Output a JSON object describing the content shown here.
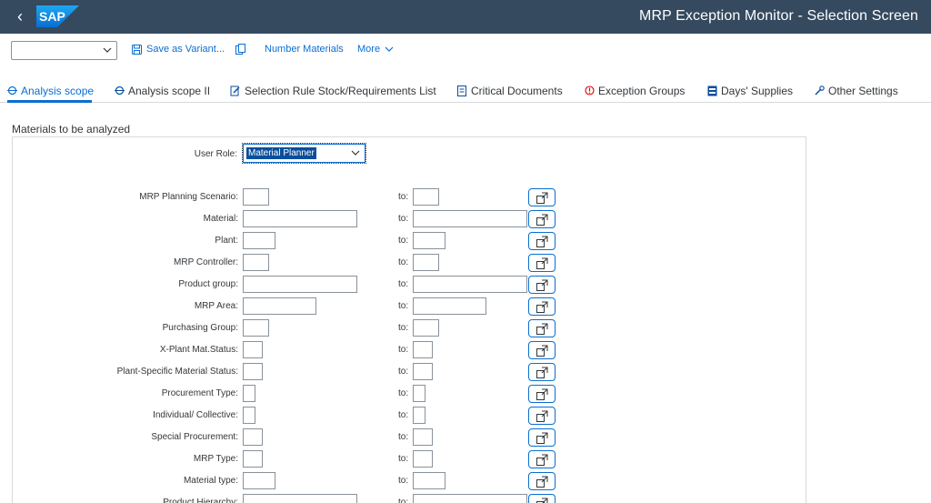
{
  "shell": {
    "back_icon": "back-arrow-icon",
    "logo_text": "SAP",
    "title": "MRP Exception Monitor - Selection Screen"
  },
  "toolbar": {
    "variant_value": "",
    "save_variant_label": "Save as Variant...",
    "number_materials_label": "Number Materials",
    "more_label": "More"
  },
  "tabs": [
    {
      "label": "Analysis scope",
      "icon": "scope-icon",
      "active": true
    },
    {
      "label": "Analysis scope II",
      "icon": "scope-icon",
      "active": false
    },
    {
      "label": "Selection Rule Stock/Requirements List",
      "icon": "selection-rule-icon",
      "active": false
    },
    {
      "label": "Critical Documents",
      "icon": "document-icon",
      "active": false
    },
    {
      "label": "Exception Groups",
      "icon": "exception-icon",
      "active": false
    },
    {
      "label": "Days' Supplies",
      "icon": "days-supply-icon",
      "active": false
    },
    {
      "label": "Other Settings",
      "icon": "settings-icon",
      "active": false
    }
  ],
  "section": {
    "title": "Materials to be analyzed",
    "user_role_label": "User Role:",
    "user_role_value": "Material Planner",
    "to_label": "to:",
    "rows": [
      {
        "label": "MRP Planning Scenario:",
        "from": "",
        "to": ""
      },
      {
        "label": "Material:",
        "from": "",
        "to": ""
      },
      {
        "label": "Plant:",
        "from": "",
        "to": ""
      },
      {
        "label": "MRP Controller:",
        "from": "",
        "to": ""
      },
      {
        "label": "Product group:",
        "from": "",
        "to": ""
      },
      {
        "label": "MRP Area:",
        "from": "",
        "to": ""
      },
      {
        "label": "Purchasing Group:",
        "from": "",
        "to": ""
      },
      {
        "label": "X-Plant Mat.Status:",
        "from": "",
        "to": ""
      },
      {
        "label": "Plant-Specific Material Status:",
        "from": "",
        "to": ""
      },
      {
        "label": "Procurement Type:",
        "from": "",
        "to": ""
      },
      {
        "label": "Individual/ Collective:",
        "from": "",
        "to": ""
      },
      {
        "label": "Special Procurement:",
        "from": "",
        "to": ""
      },
      {
        "label": "MRP Type:",
        "from": "",
        "to": ""
      },
      {
        "label": "Material type:",
        "from": "",
        "to": ""
      },
      {
        "label": "Product Hierarchy:",
        "from": "",
        "to": ""
      }
    ]
  },
  "colors": {
    "shell_bg": "#354a5f",
    "accent": "#0a6ed1",
    "exception_red": "#e00000"
  }
}
